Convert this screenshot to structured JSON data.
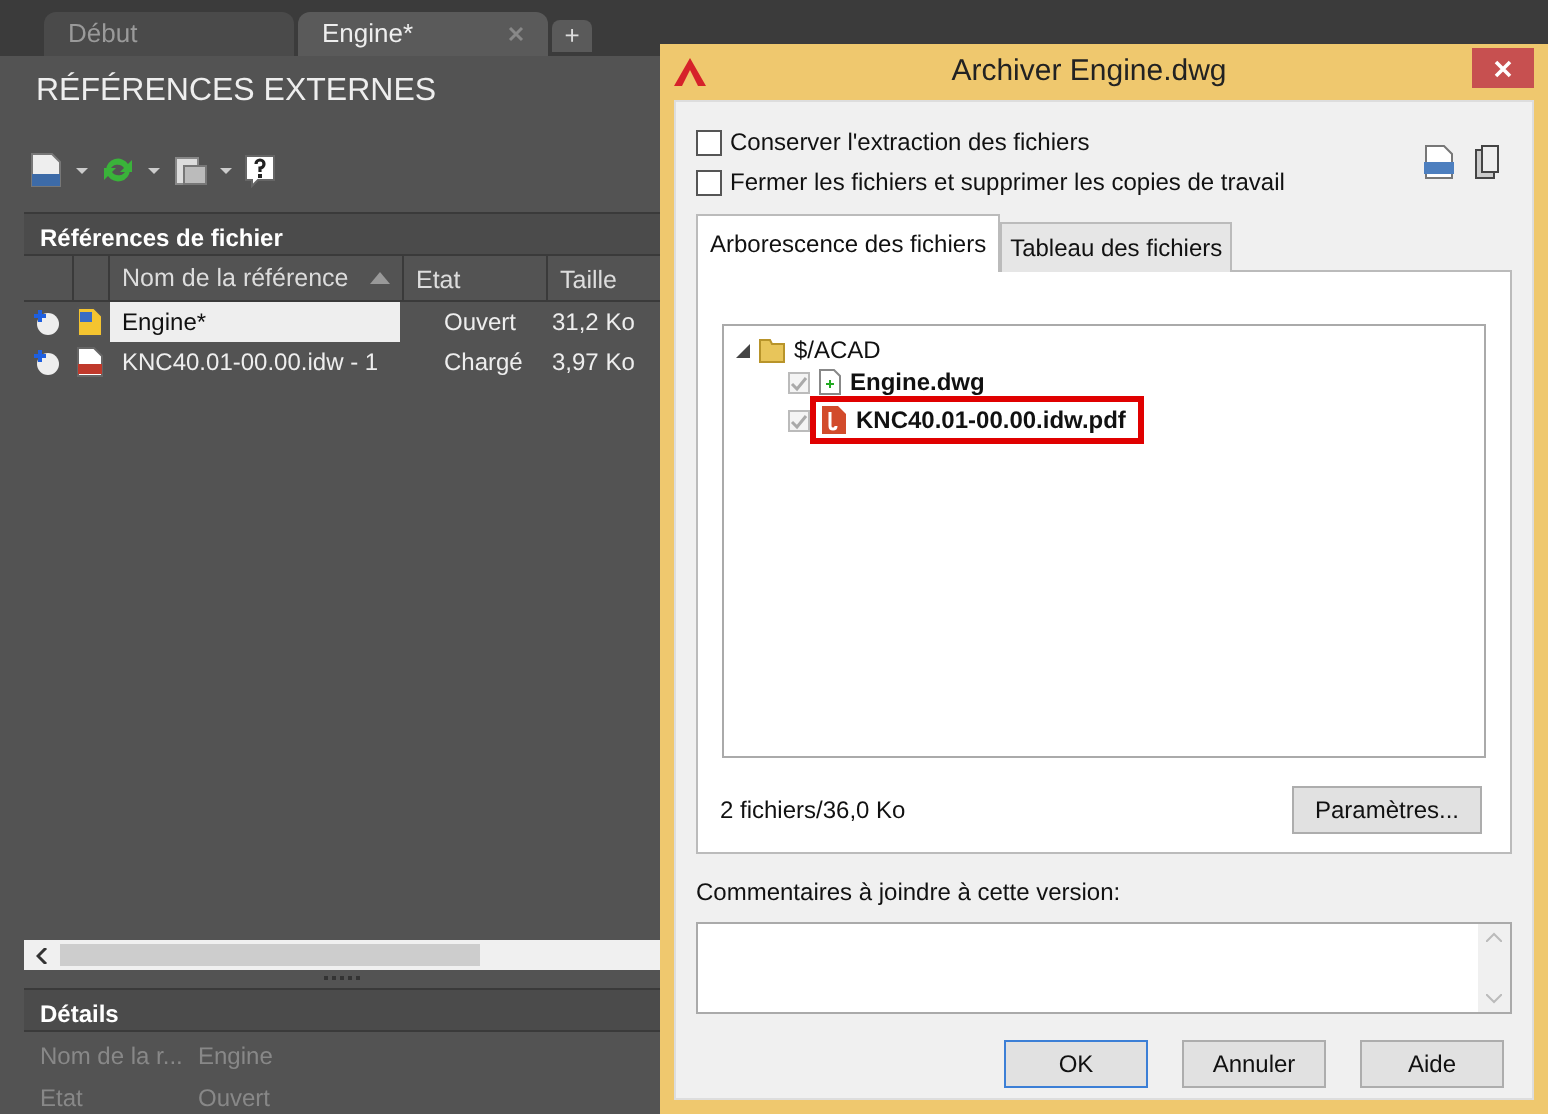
{
  "doc_tabs": [
    {
      "label": "Début",
      "selected": false,
      "closable": false
    },
    {
      "label": "Engine*",
      "selected": true,
      "closable": true
    }
  ],
  "new_tab": "+",
  "palette": {
    "title": "RÉFÉRENCES EXTERNES",
    "section": "Références de fichier",
    "columns": [
      "Nom de la référence",
      "Etat",
      "Taille"
    ],
    "rows": [
      {
        "name": "Engine*",
        "status": "Ouvert",
        "size": "31,2 Ko",
        "selected": true,
        "kind": "dwg"
      },
      {
        "name": "KNC40.01-00.00.idw - 1",
        "status": "Chargé",
        "size": "3,97 Ko",
        "selected": false,
        "kind": "pdf"
      }
    ],
    "details": {
      "title": "Détails",
      "rows": [
        {
          "label": "Nom de la r...",
          "value": "Engine"
        },
        {
          "label": "Etat",
          "value": "Ouvert"
        }
      ]
    }
  },
  "dialog": {
    "title": "Archiver Engine.dwg",
    "options": [
      {
        "label": "Conserver l'extraction des fichiers",
        "checked": false
      },
      {
        "label": "Fermer les fichiers et supprimer les copies de travail",
        "checked": false
      }
    ],
    "tabs": [
      {
        "label": "Arborescence des fichiers",
        "selected": true
      },
      {
        "label": "Tableau des fichiers",
        "selected": false
      }
    ],
    "tree": [
      {
        "label": "$/ACAD",
        "expanded": true,
        "children": [
          {
            "label": "Engine.dwg",
            "checked": true,
            "kind": "dwg",
            "highlighted": false
          },
          {
            "label": "KNC40.01-00.00.idw.pdf",
            "checked": true,
            "kind": "pdf",
            "highlighted": true
          }
        ]
      }
    ],
    "summary": "2 fichiers/36,0 Ko",
    "settings_button": "Paramètres...",
    "comment_label": "Commentaires à joindre à cette version:",
    "buttons": [
      {
        "label": "OK",
        "default": true
      },
      {
        "label": "Annuler",
        "default": false
      },
      {
        "label": "Aide",
        "default": false
      }
    ]
  }
}
